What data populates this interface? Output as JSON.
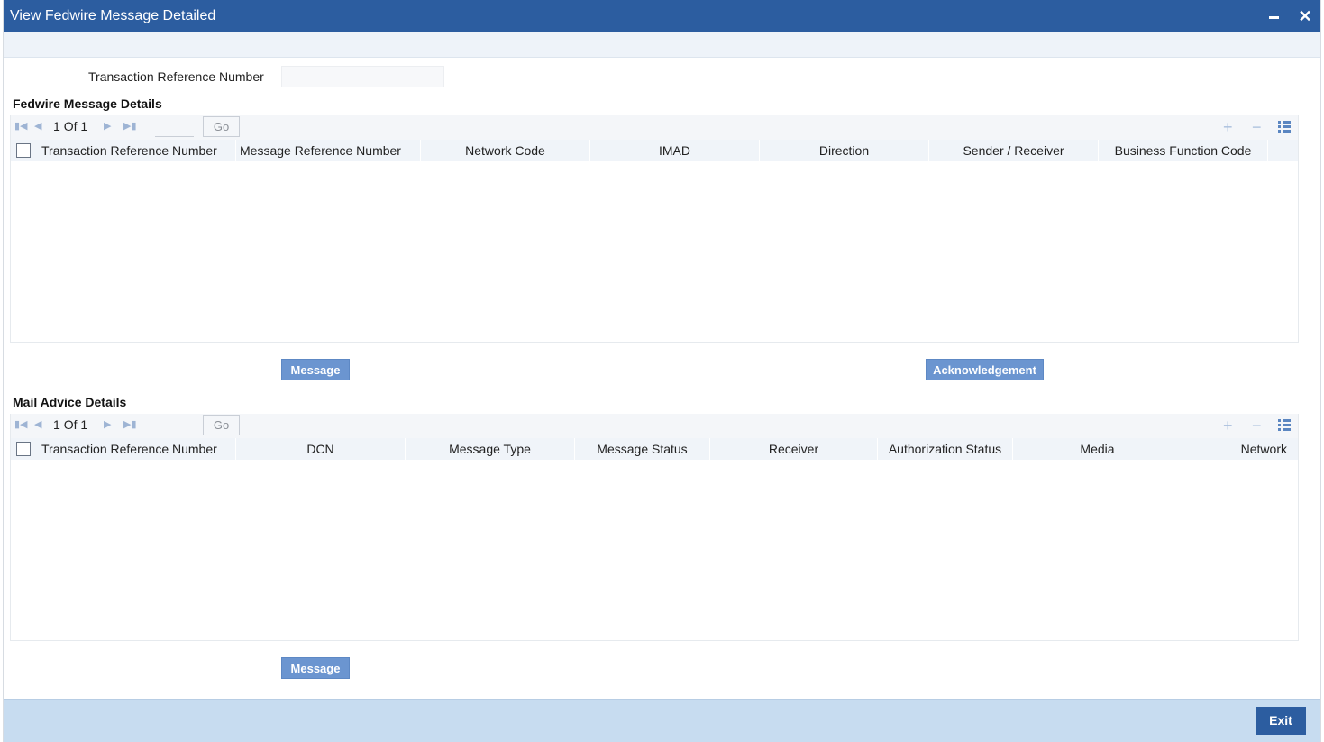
{
  "window": {
    "title": "View Fedwire Message Detailed",
    "minimize_icon": "minimize-icon",
    "close_label": "✕"
  },
  "form": {
    "trn_label": "Transaction Reference Number",
    "trn_value": ""
  },
  "fedwire": {
    "section_title": "Fedwire Message Details",
    "pager": {
      "current": "1",
      "of_label": "Of",
      "total": "1",
      "go_label": "Go"
    },
    "columns": [
      "Transaction Reference Number",
      "Message Reference Number",
      "Network Code",
      "IMAD",
      "Direction",
      "Sender / Receiver",
      "Business Function Code"
    ],
    "rows": [],
    "message_button": "Message",
    "ack_button": "Acknowledgement"
  },
  "mail": {
    "section_title": "Mail Advice Details",
    "pager": {
      "current": "1",
      "of_label": "Of",
      "total": "1",
      "go_label": "Go"
    },
    "columns": [
      "Transaction Reference Number",
      "DCN",
      "Message Type",
      "Message Status",
      "Receiver",
      "Authorization Status",
      "Media",
      "Network"
    ],
    "rows": [],
    "message_button": "Message"
  },
  "footer": {
    "exit_label": "Exit"
  }
}
